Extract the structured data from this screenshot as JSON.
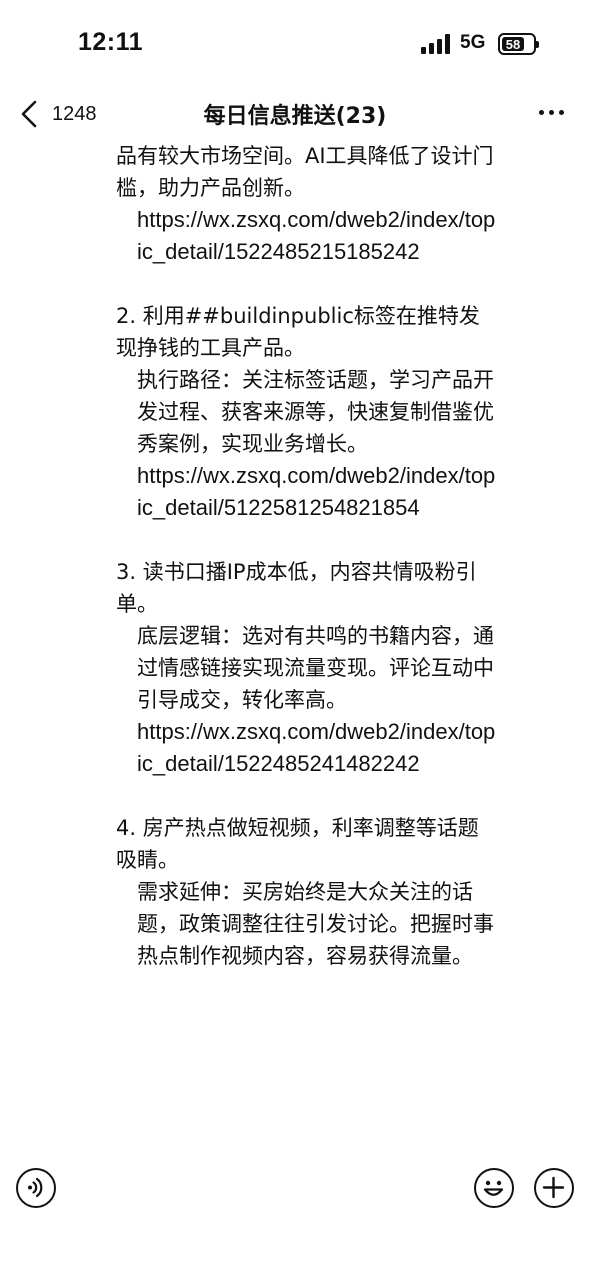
{
  "status_bar": {
    "time": "12:11",
    "network": "5G",
    "battery": "58"
  },
  "nav": {
    "back_count": "1248",
    "title": "每日信息推送(23)"
  },
  "message": {
    "paragraphs": [
      {
        "kind": "text",
        "text": "品有较大市场空间。AI工具降低了设计门槛，助力产品创新。"
      },
      {
        "kind": "url",
        "text": "https://wx.zsxq.com/dweb2/index/topic_detail/1522485215185242"
      },
      {
        "kind": "gap",
        "text": ""
      },
      {
        "kind": "text",
        "text": "2. 利用##buildinpublic标签在推特发现挣钱的工具产品。"
      },
      {
        "kind": "indent",
        "text": "执行路径：关注标签话题，学习产品开发过程、获客来源等，快速复制借鉴优秀案例，实现业务增长。"
      },
      {
        "kind": "url",
        "text": "https://wx.zsxq.com/dweb2/index/topic_detail/5122581254821854"
      },
      {
        "kind": "gap",
        "text": ""
      },
      {
        "kind": "text",
        "text": "3. 读书口播IP成本低，内容共情吸粉引单。"
      },
      {
        "kind": "indent",
        "text": "底层逻辑：选对有共鸣的书籍内容，通过情感链接实现流量变现。评论互动中引导成交，转化率高。"
      },
      {
        "kind": "url",
        "text": "https://wx.zsxq.com/dweb2/index/topic_detail/1522485241482242"
      },
      {
        "kind": "gap",
        "text": ""
      },
      {
        "kind": "text",
        "text": "4. 房产热点做短视频，利率调整等话题吸睛。"
      },
      {
        "kind": "indent",
        "text": "需求延伸：买房始终是大众关注的话题，政策调整往往引发讨论。把握时事热点制作视频内容，容易获得流量。"
      }
    ]
  },
  "toolbar": {
    "voice_icon": "voice-icon",
    "emoji_icon": "emoji-icon",
    "plus_icon": "plus-icon"
  }
}
